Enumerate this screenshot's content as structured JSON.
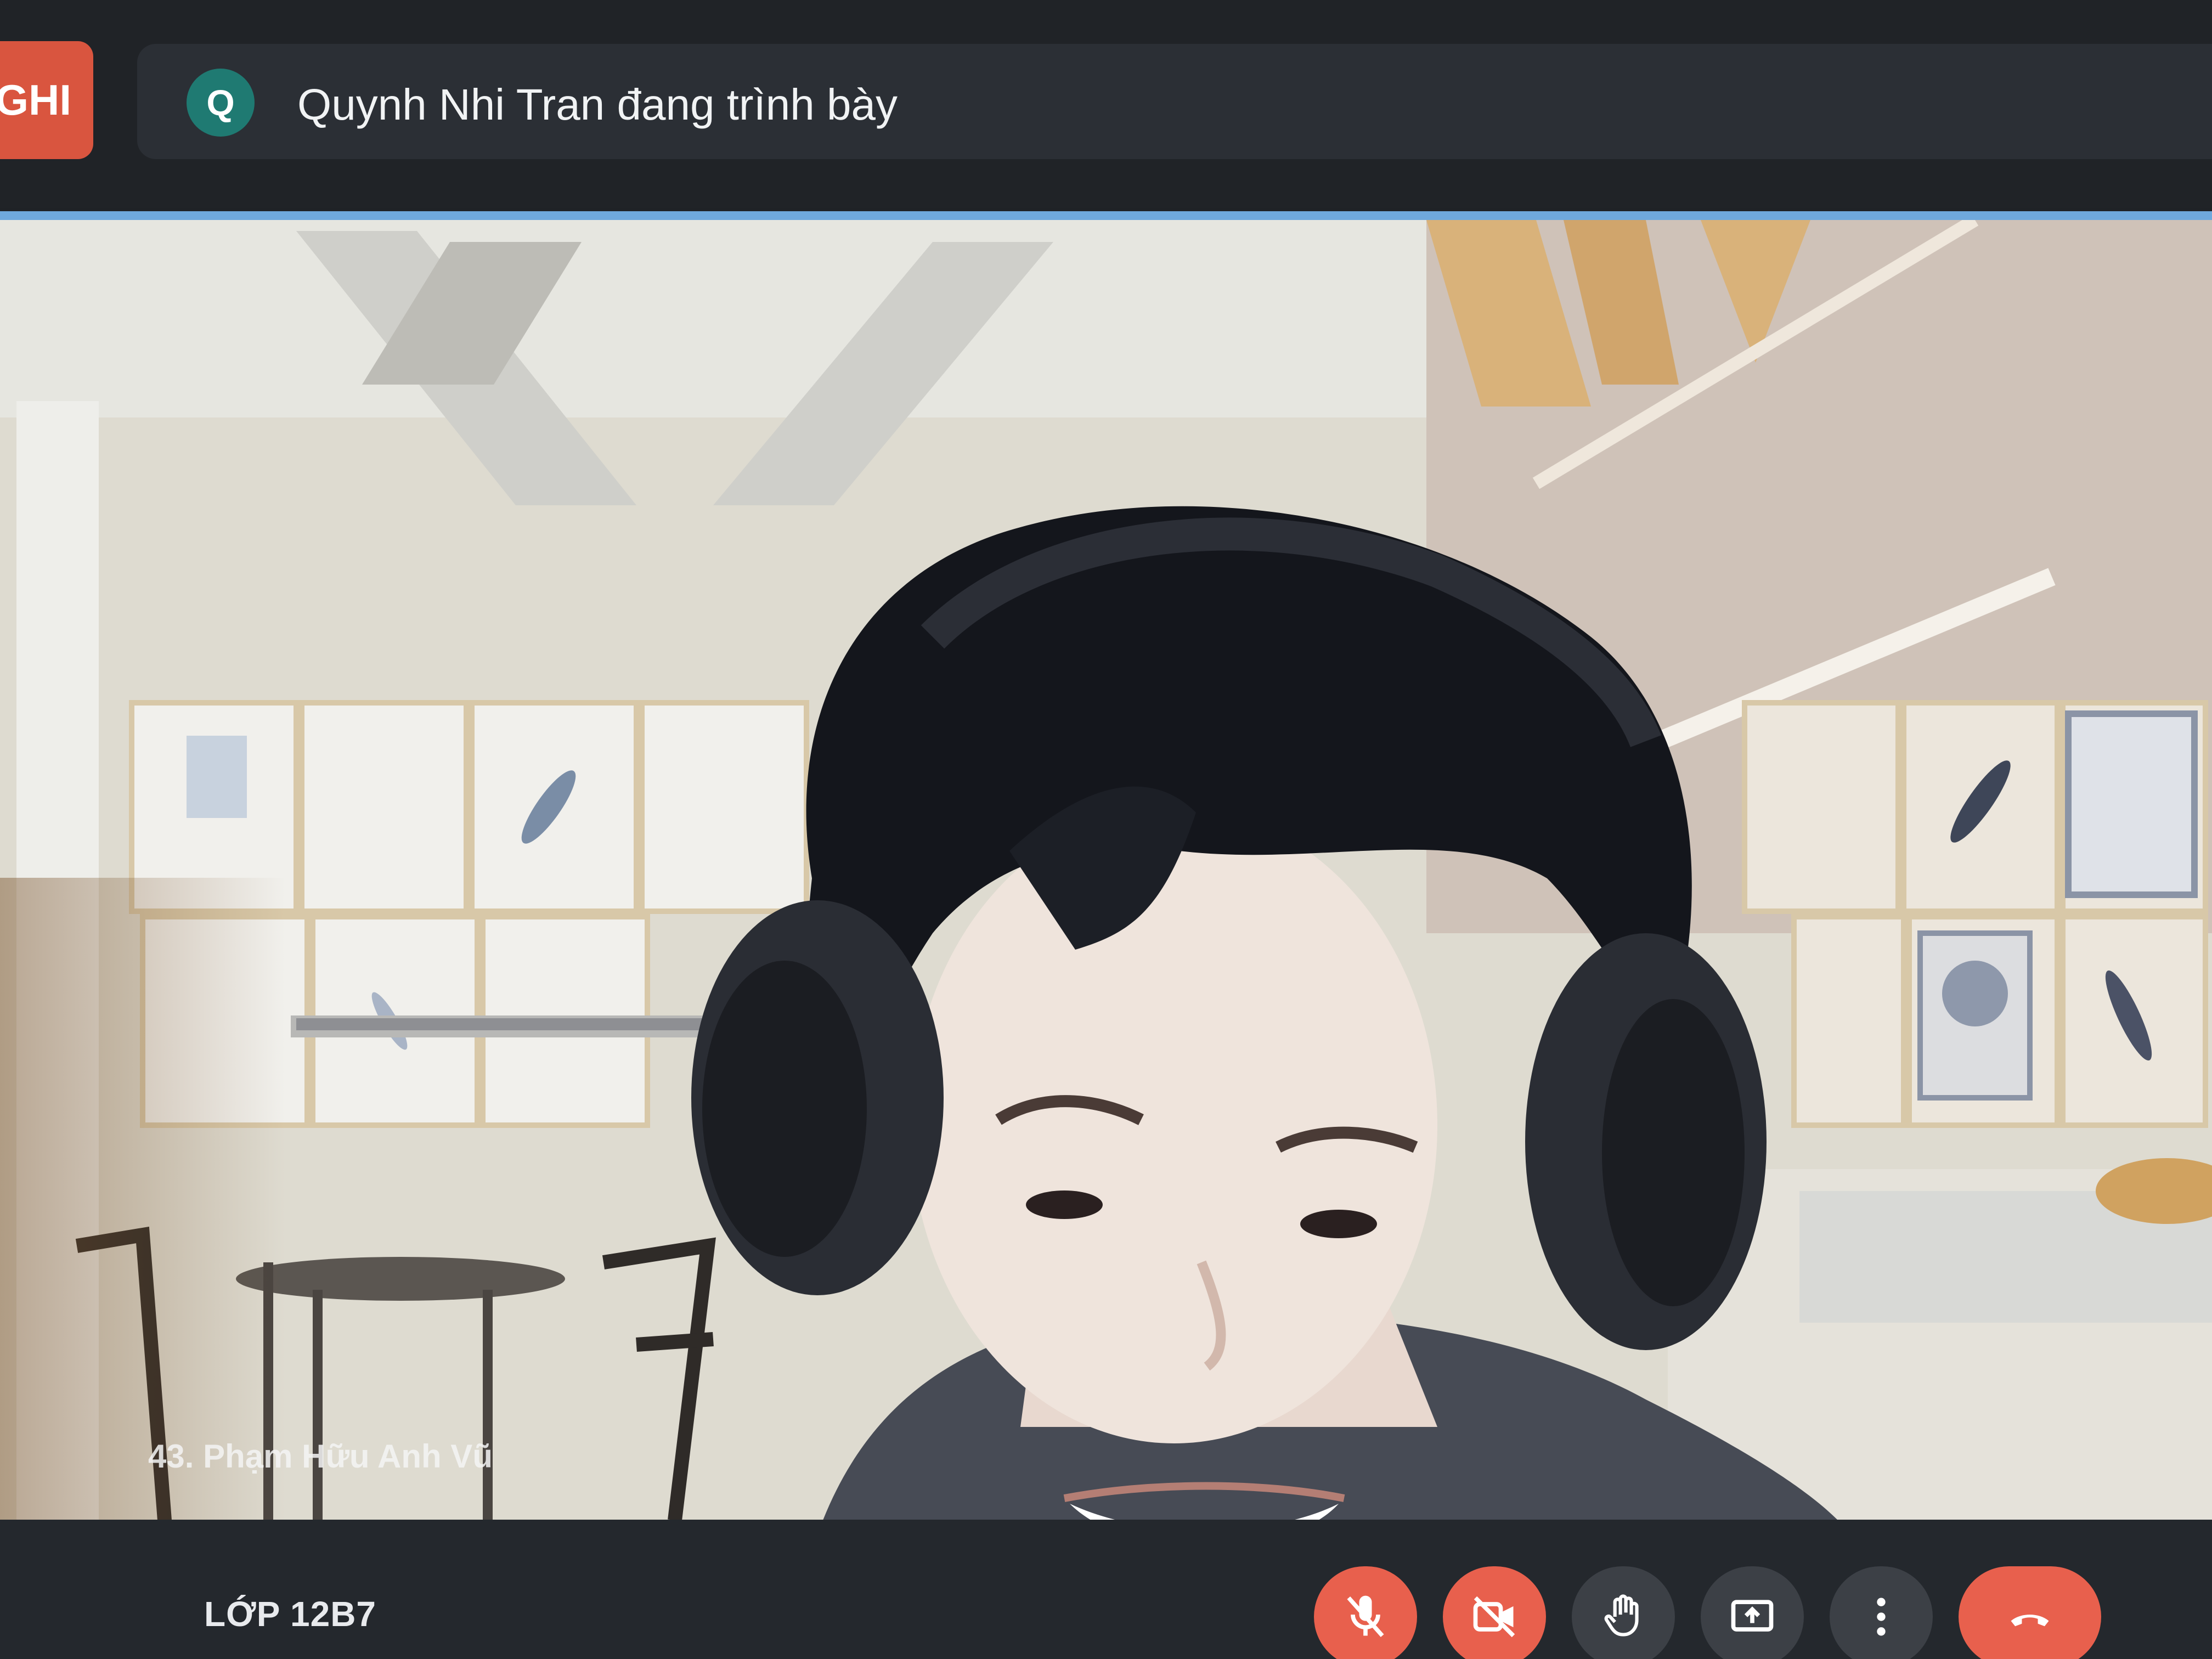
{
  "recording_badge": {
    "label": "GHI"
  },
  "presenter": {
    "avatar_letter": "Q",
    "text": "Quynh Nhi Tran đang trình bày"
  },
  "video": {
    "participant_name": "43. Phạm Hữu Anh Vũ"
  },
  "meeting": {
    "title": "LỚP 12B7"
  },
  "controls": [
    {
      "name": "mic-button",
      "icon": "mic-off-icon",
      "state": "off"
    },
    {
      "name": "camera-button",
      "icon": "camera-off-icon",
      "state": "off"
    },
    {
      "name": "raise-hand-button",
      "icon": "hand-icon"
    },
    {
      "name": "present-button",
      "icon": "present-screen-icon"
    },
    {
      "name": "more-options-button",
      "icon": "more-vert-icon"
    },
    {
      "name": "leave-call-button",
      "icon": "call-end-icon"
    }
  ],
  "colors": {
    "accent_red": "#e8604d",
    "avatar_teal": "#1f7a72",
    "tile_border": "#6fa8dc"
  }
}
